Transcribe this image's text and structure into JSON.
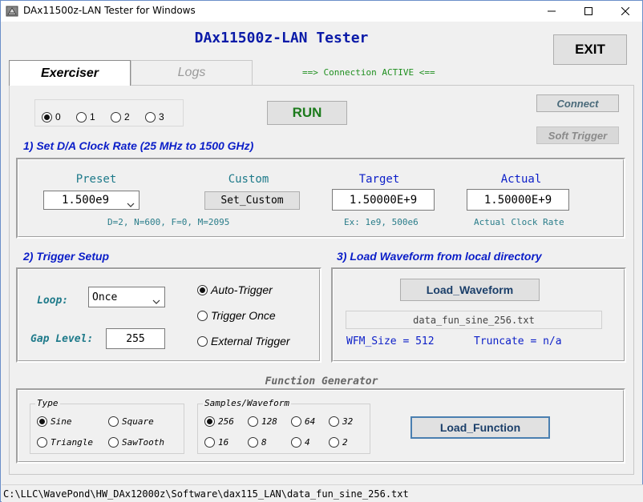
{
  "window": {
    "title": "DAx11500z-LAN Tester for Windows",
    "controls": {
      "minimize": "minimize-icon",
      "maximize": "maximize-icon",
      "close": "close-icon"
    }
  },
  "header": {
    "app_title": "DAx11500z-LAN Tester",
    "exit_label": "EXIT",
    "connection_status": "==> Connection ACTIVE <=="
  },
  "tabs": [
    {
      "label": "Exerciser",
      "active": true
    },
    {
      "label": "Logs",
      "active": false
    }
  ],
  "channels": {
    "options": [
      "0",
      "1",
      "2",
      "3"
    ],
    "selected": "0"
  },
  "run_label": "RUN",
  "connect_label": "Connect",
  "soft_trigger_label": "Soft Trigger",
  "clock": {
    "heading": "1) Set D/A Clock Rate   (25 MHz to 1500 GHz)",
    "preset_label": "Preset",
    "preset_value": "1.500e9",
    "preset_note": "D=2, N=600, F=0, M=2095",
    "custom_label": "Custom",
    "set_custom_label": "Set_Custom",
    "target_label": "Target",
    "target_value": "1.50000E+9",
    "target_note": "Ex: 1e9, 500e6",
    "actual_label": "Actual",
    "actual_value": "1.50000E+9",
    "actual_note": "Actual Clock Rate"
  },
  "trigger": {
    "heading": "2) Trigger Setup",
    "loop_label": "Loop:",
    "loop_value": "Once",
    "gap_label": "Gap Level:",
    "gap_value": "255",
    "modes": [
      "Auto-Trigger",
      "Trigger Once",
      "External Trigger"
    ],
    "selected_mode": "Auto-Trigger"
  },
  "waveform": {
    "heading": "3) Load Waveform from local directory",
    "load_label": "Load_Waveform",
    "filename": "data_fun_sine_256.txt",
    "wfm_size": "WFM_Size = 512",
    "truncate": "Truncate = n/a"
  },
  "function_generator": {
    "title": "Function Generator",
    "type_legend": "Type",
    "types": [
      "Sine",
      "Square",
      "Triangle",
      "SawTooth"
    ],
    "selected_type": "Sine",
    "samples_legend": "Samples/Waveform",
    "samples": [
      "256",
      "128",
      "64",
      "32",
      "16",
      "8",
      "4",
      "2"
    ],
    "selected_samples": "256",
    "load_label": "Load_Function"
  },
  "status_bar": {
    "path": "C:\\LLC\\WavePond\\HW_DAx12000z\\Software\\dax115_LAN\\data_fun_sine_256.txt"
  },
  "colors": {
    "title_blue": "#0a1aa8",
    "section_blue": "#0b1ec8",
    "run_green": "#1c7a1c",
    "status_green": "#1f8f1f",
    "teal_label": "#1e7a8a"
  }
}
